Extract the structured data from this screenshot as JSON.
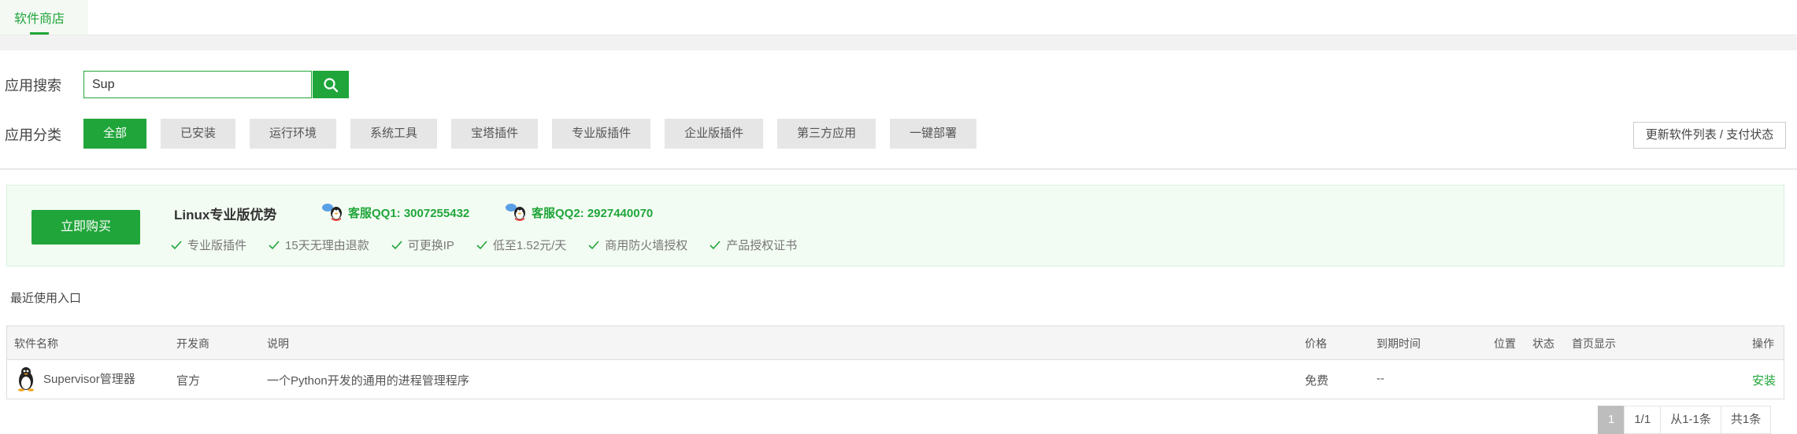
{
  "tabs": {
    "active": "软件商店"
  },
  "search": {
    "label": "应用搜索",
    "value": "Sup"
  },
  "categories": {
    "label": "应用分类",
    "items": [
      "全部",
      "已安装",
      "运行环境",
      "系统工具",
      "宝塔插件",
      "专业版插件",
      "企业版插件",
      "第三方应用",
      "一键部署"
    ]
  },
  "update_button": "更新软件列表 / 支付状态",
  "promo": {
    "buy_button": "立即购买",
    "title": "Linux专业版优势",
    "qq1": "客服QQ1: 3007255432",
    "qq2": "客服QQ2: 2927440070",
    "features": [
      "专业版插件",
      "15天无理由退款",
      "可更换IP",
      "低至1.52元/天",
      "商用防火墙授权",
      "产品授权证书"
    ]
  },
  "recent_label": "最近使用入口",
  "table": {
    "headers": {
      "name": "软件名称",
      "developer": "开发商",
      "description": "说明",
      "price": "价格",
      "expiry": "到期时间",
      "position": "位置",
      "status": "状态",
      "homepage": "首页显示",
      "action": "操作"
    },
    "rows": [
      {
        "name": "Supervisor管理器",
        "developer": "官方",
        "description": "一个Python开发的通用的进程管理程序",
        "price": "免费",
        "expiry": "--",
        "action": "安装"
      }
    ]
  },
  "pagination": {
    "current": "1",
    "pages": "1/1",
    "range": "从1-1条",
    "total": "共1条"
  },
  "colors": {
    "accent": "#20a53a",
    "promo_bg": "#f3fcf3"
  }
}
